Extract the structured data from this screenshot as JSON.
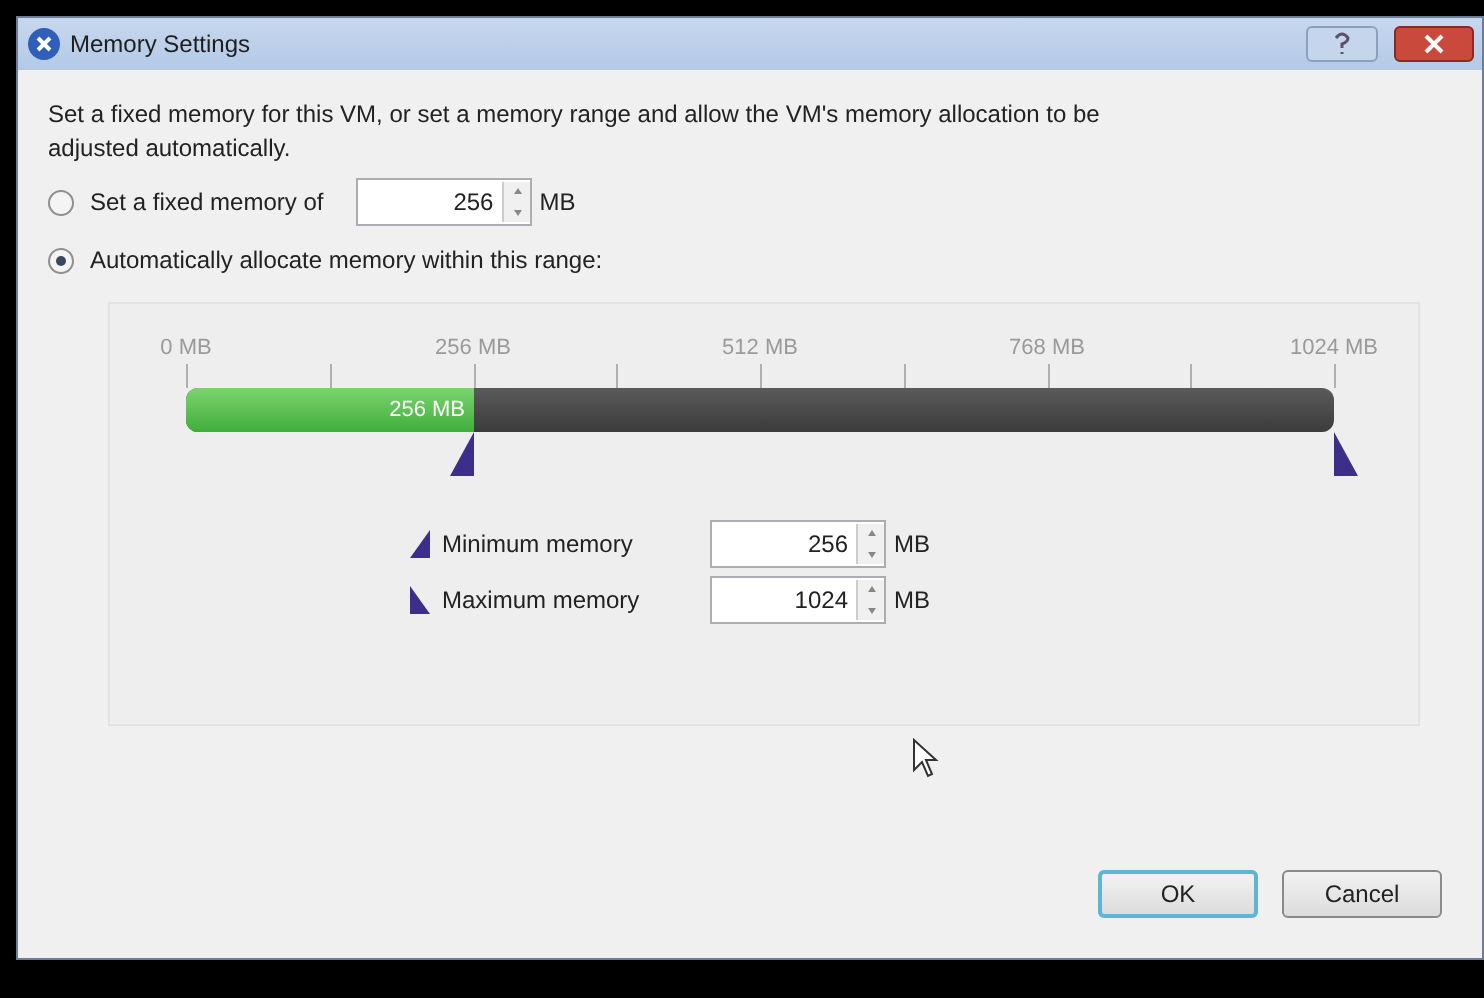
{
  "window": {
    "title": "Memory Settings"
  },
  "description": "Set a fixed memory for this VM, or set a memory range and allow the VM's memory allocation to be adjusted automatically.",
  "options": [
    {
      "label": "Set a fixed memory of",
      "selected": false,
      "value": "256",
      "unit": "MB"
    },
    {
      "label": "Automatically allocate memory within this range:",
      "selected": true
    }
  ],
  "range": {
    "tick_labels": [
      "0 MB",
      "256 MB",
      "512 MB",
      "768 MB",
      "1024 MB"
    ],
    "fill": {
      "level": 0.25,
      "label": "256 MB"
    },
    "min_thumb": {
      "level": 0.25
    },
    "max_thumb": {
      "level": 1
    }
  },
  "fields": [
    {
      "kind": "min",
      "label": "Minimum memory",
      "value": "256",
      "unit": "MB"
    },
    {
      "kind": "max",
      "label": "Maximum memory",
      "value": "1024",
      "unit": "MB"
    }
  ],
  "buttons": [
    {
      "label": "OK",
      "default": true
    },
    {
      "label": "Cancel",
      "default": false
    }
  ]
}
